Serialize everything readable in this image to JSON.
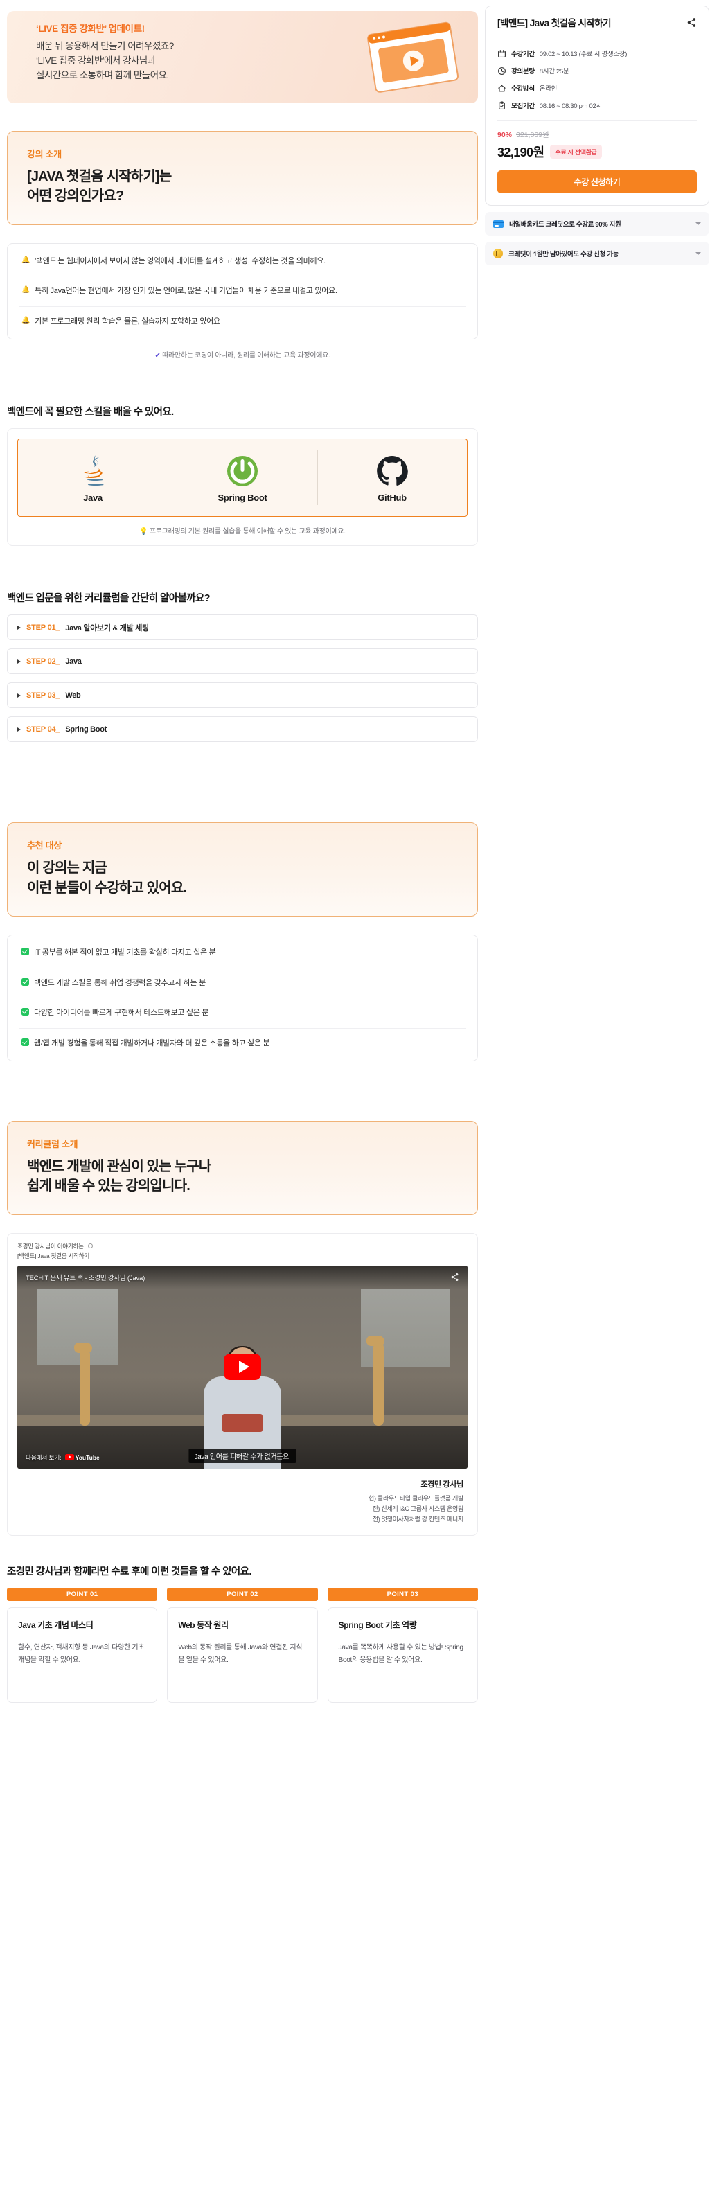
{
  "hero": {
    "eyebrow": "‘LIVE 집중 강화반’ 업데이트!",
    "line1": "배운 뒤 응용해서 만들기 어려우셨죠?",
    "line2": "‘LIVE 집중 강화반'에서 강사님과",
    "line3": "실시간으로 소통하며 함께 만들어요."
  },
  "intro": {
    "eyebrow": "강의 소개",
    "title_line1": "[JAVA 첫걸음 시작하기]는",
    "title_line2": "어떤 강의인가요?",
    "bullets": [
      "'백엔드'는 웹페이지에서 보이지 않는 영역에서 데이터를 설계하고 생성, 수정하는 것을 의미해요.",
      "특히 Java언어는 현업에서 가장 인기 있는 언어로, 많은 국내 기업들이 채용 기준으로 내걸고 있어요.",
      "기본 프로그래밍 원리 학습은 물론, 실습까지 포함하고 있어요"
    ],
    "caption_tick": "✔",
    "caption": "따라만하는 코딩이 아니라, 원리를 이해하는 교육 과정이에요."
  },
  "skills": {
    "heading": "백엔드에 꼭 필요한 스킬을 배울 수 있어요.",
    "items": [
      {
        "name": "Java",
        "icon": "java-logo"
      },
      {
        "name": "Spring Boot",
        "icon": "spring-boot-logo"
      },
      {
        "name": "GitHub",
        "icon": "github-logo"
      }
    ],
    "caption_icon": "💡",
    "caption": "프로그래밍의 기본 원리를 실습을 통해 이해할 수 있는 교육 과정이에요."
  },
  "curriculum_steps": {
    "heading": "백엔드 입문을 위한 커리큘럼을 간단히 알아볼까요?",
    "steps": [
      {
        "num": "STEP 01_",
        "label": "Java 알아보기 & 개발 세팅"
      },
      {
        "num": "STEP 02_",
        "label": "Java"
      },
      {
        "num": "STEP 03_",
        "label": "Web"
      },
      {
        "num": "STEP 04_",
        "label": "Spring Boot"
      }
    ]
  },
  "target": {
    "eyebrow": "추천 대상",
    "title_line1": "이 강의는 지금",
    "title_line2": "이런 분들이 수강하고 있어요.",
    "items": [
      "IT 공부를 해본 적이 없고 개발 기초를 확실히 다지고 싶은 분",
      "백엔드 개발 스킬을 통해 취업 경쟁력을 갖추고자 하는 분",
      "다양한 아이디어를 빠르게 구현해서 테스트해보고 싶은 분",
      "웹/앱 개발 경험을 통해 직접 개발하거나 개발자와 더 깊은 소통을 하고 싶은 분"
    ]
  },
  "curriculum_intro": {
    "eyebrow": "커리큘럼 소개",
    "title_line1": "백엔드 개발에 관심이 있는 누구나",
    "title_line2": "쉽게 배울 수 있는 강의입니다."
  },
  "video": {
    "meta": "조경민 강사님이 이야기하는",
    "sub": "[백엔드] Java 첫걸음 시작하기",
    "yt_title": "TECHIT 온새 유트 백 - 조경민 강사님 (Java)",
    "watch_prefix": "다음에서 보기:",
    "watch_brand": "YouTube",
    "subtitle": "Java 언어를 피해갈 수가 없거든요.",
    "share_icon": "share-icon",
    "play_icon": "play-icon"
  },
  "instructor": {
    "name": "조경민 강사님",
    "lines": [
      "현) 클라우드타입 클라우드플랫폼 개발",
      "전) 신세계 I&C 그룹사 시스템 운영팀",
      "전) 멋쟁이사자처럼 강 컨텐츠 매니저"
    ]
  },
  "points": {
    "heading": "조경민 강사님과 함께라면 수료 후에 이런 것들을 할 수 있어요.",
    "cards": [
      {
        "badge": "POINT 01",
        "title": "Java 기초 개념 마스터",
        "desc": "함수, 연산자, 객채지향 등 Java의 다양한 기초 개념을 익힐 수 있어요."
      },
      {
        "badge": "POINT 02",
        "title": "Web 동작 원리",
        "desc": "Web의 동작 원리를 통해 Java와 연결된 지식을 얻을 수 있어요."
      },
      {
        "badge": "POINT 03",
        "title": "Spring Boot 기초 역량",
        "desc": "Java를 똑똑하게 사용할 수 있는 방법! Spring Boot의 응용법을 알 수 있어요."
      }
    ]
  },
  "sidebar": {
    "title": "[백엔드] Java 첫걸음 시작하기",
    "share_icon": "share-icon",
    "info": [
      {
        "icon": "calendar-icon",
        "key": "수강기간",
        "value": "09.02 ~ 10.13 (수료 시 평생소장)"
      },
      {
        "icon": "clock-icon",
        "key": "강의분량",
        "value": "8시간 25분"
      },
      {
        "icon": "home-icon",
        "key": "수강방식",
        "value": "온라인"
      },
      {
        "icon": "clipboard-icon",
        "key": "모집기간",
        "value": "08.16 ~ 08.30 pm 02시"
      }
    ],
    "discount_pct": "90%",
    "price_original": "321,869원",
    "price_now": "32,190원",
    "refund_badge": "수료 시 전액환급",
    "cta_label": "수강 신청하기",
    "benefits": [
      {
        "icon": "credit-card-icon",
        "text": "내일배움카드 크레딧으로 수강료 90% 지원"
      },
      {
        "icon": "coin-icon",
        "text": "크레딧이 1원만 남아있어도 수강 신청 가능"
      }
    ]
  },
  "colors": {
    "brand_orange": "#f6821f",
    "accent_orange": "#ef8120",
    "red": "#e8434f",
    "green": "#22c55e",
    "peach_bg": "#fdf0e4"
  }
}
